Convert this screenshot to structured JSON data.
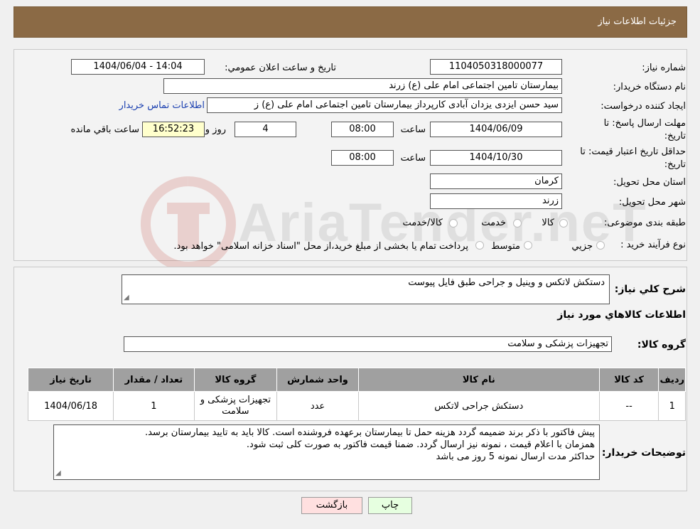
{
  "header": {
    "title": "جزئیات اطلاعات نیاز"
  },
  "form": {
    "need_number_label": "شماره نیاز:",
    "need_number": "1104050318000077",
    "announce_label": "تاریخ و ساعت اعلان عمومي:",
    "announce_value": "1404/06/04 - 14:04",
    "buyer_label": "نام دستگاه خریدار:",
    "buyer_value": "بیمارستان تامین اجتماعی امام علی (ع) زرند",
    "creator_label": "ایجاد کننده درخواست:",
    "creator_value": "سید حسن ایزدی یزدان آبادی کارپرداز بیمارستان تامین اجتماعی امام علی (ع) ز",
    "contact_link": "اطلاعات تماس خریدار",
    "deadline_label_1": "مهلت ارسال پاسخ: تا",
    "deadline_label_2": "تاریخ:",
    "deadline_date": "1404/06/09",
    "time_label": "ساعت",
    "deadline_time": "08:00",
    "days_value": "4",
    "days_label": "روز و",
    "remaining_time": "16:52:23",
    "remaining_label": "ساعت باقي مانده",
    "validity_label_1": "حداقل تاریخ اعتبار قیمت: تا",
    "validity_label_2": "تاریخ:",
    "validity_date": "1404/10/30",
    "validity_time": "08:00",
    "province_label": "استان محل تحویل:",
    "province_value": "کرمان",
    "city_label": "شهر محل تحویل:",
    "city_value": "زرند",
    "category_label": "طبقه بندی موضوعی:",
    "category_options": [
      "کالا",
      "خدمت",
      "کالا/خدمت"
    ],
    "process_label": "نوع فرآیند خرید :",
    "process_options": [
      "جزيي",
      "متوسط"
    ],
    "process_note": "پرداخت تمام یا بخشی از مبلغ خرید،از محل \"اسناد خزانه اسلامی\" خواهد بود."
  },
  "details": {
    "summary_label": "شرح کلي نیاز:",
    "summary_value": "دستکش لاتکس و وینیل و جراحی  طبق فایل پیوست",
    "goods_info_title": "اطلاعات کالاهاي مورد نیاز",
    "goods_group_label": "گروه کالا:",
    "goods_group_value": "تجهیزات پزشکی و سلامت"
  },
  "table": {
    "headers": [
      "ردیف",
      "کد کالا",
      "نام کالا",
      "واحد شمارش",
      "گروه کالا",
      "تعداد / مقدار",
      "تاریخ نیاز"
    ],
    "rows": [
      [
        "1",
        "--",
        "دستکش جراحی لاتکس",
        "عدد",
        "تجهیزات پزشکی و سلامت",
        "1",
        "1404/06/18"
      ]
    ]
  },
  "buyer_notes": {
    "label": "توضیحات خریدار:",
    "lines": [
      "پیش فاکتور با ذکر برند ضمیمه گردد هزینه حمل تا بیمارستان برعهده فروشنده است. کالا باید به تایید بیمارستان برسد.",
      "همزمان با اعلام قیمت ، نمونه نیز ارسال گردد. ضمنا قیمت فاکتور به صورت کلی ثبت شود.",
      "حداکثر مدت ارسال نمونه 5 روز می باشد"
    ]
  },
  "buttons": {
    "print": "چاپ",
    "back": "بازگشت"
  },
  "watermark": {
    "text": "AriaTender.neT"
  },
  "colors": {
    "header_bg": "#8b6a45",
    "link": "#1a3fb0",
    "time_box": "#ffffcc",
    "back_button": "#ffe0e0",
    "print_button": "#e6ffe0"
  }
}
